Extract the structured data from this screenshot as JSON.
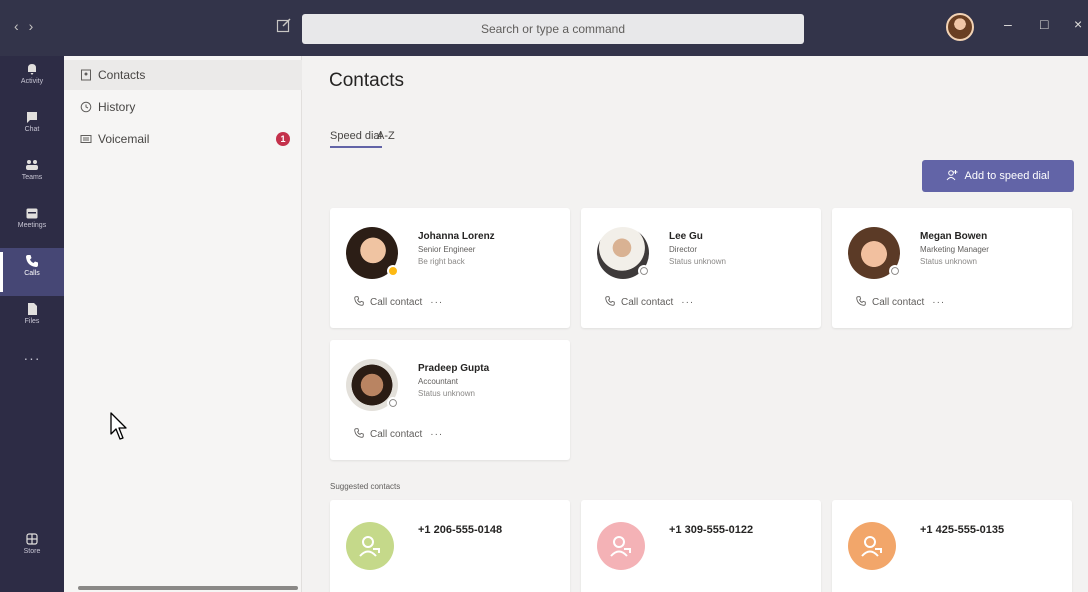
{
  "titlebar": {
    "back_arrow": "‹",
    "forward_arrow": "›",
    "search_placeholder": "Search or type a command",
    "minimize": "–",
    "maximize": "□",
    "close": "×"
  },
  "rail": {
    "items": [
      {
        "label": "Activity",
        "icon": "bell-icon"
      },
      {
        "label": "Chat",
        "icon": "chat-icon"
      },
      {
        "label": "Teams",
        "icon": "teams-icon"
      },
      {
        "label": "Meetings",
        "icon": "calendar-icon"
      },
      {
        "label": "Calls",
        "icon": "phone-icon"
      },
      {
        "label": "Files",
        "icon": "file-icon"
      }
    ],
    "more": "···",
    "store": "Store",
    "active": "Calls"
  },
  "sidebar": {
    "items": [
      {
        "label": "Contacts",
        "icon": "contacts-icon"
      },
      {
        "label": "History",
        "icon": "clock-icon"
      },
      {
        "label": "Voicemail",
        "icon": "voicemail-icon"
      }
    ],
    "voicemail_badge": "1"
  },
  "main": {
    "title": "Contacts",
    "tabs": [
      "Speed dial",
      "A-Z"
    ],
    "add_button": "Add to speed dial",
    "call_label": "Call contact",
    "more_label": "···",
    "contacts": [
      {
        "name": "Johanna Lorenz",
        "title": "Senior Engineer",
        "status": "Be right back",
        "presence": "away"
      },
      {
        "name": "Lee Gu",
        "title": "Director",
        "status": "Status unknown",
        "presence": "unknown"
      },
      {
        "name": "Megan Bowen",
        "title": "Marketing Manager",
        "status": "Status unknown",
        "presence": "unknown"
      },
      {
        "name": "Pradeep Gupta",
        "title": "Accountant",
        "status": "Status unknown",
        "presence": "unknown"
      }
    ],
    "suggested_label": "Suggested contacts",
    "suggested": [
      {
        "number": "+1 206-555-0148",
        "color": "#c5d98a"
      },
      {
        "number": "+1 309-555-0122",
        "color": "#f4b2b6"
      },
      {
        "number": "+1 425-555-0135",
        "color": "#f2a66a"
      }
    ]
  },
  "colors": {
    "accent": "#6264a7",
    "titlebar": "#33344a",
    "rail": "#2d2c45",
    "badge": "#c4314b"
  }
}
